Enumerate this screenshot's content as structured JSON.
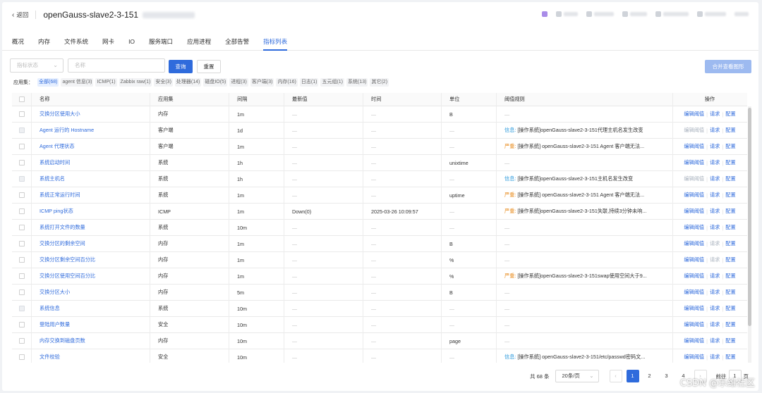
{
  "header": {
    "back_label": "返回",
    "host_title": "openGauss-slave2-3-151"
  },
  "tabs": [
    "概况",
    "内存",
    "文件系统",
    "网卡",
    "IO",
    "服务端口",
    "应用进程",
    "全部告警",
    "指标列表"
  ],
  "active_tab": 8,
  "filters": {
    "status_placeholder": "指标状态",
    "name_placeholder": "名称",
    "query_label": "查询",
    "reset_label": "重置",
    "merge_label": "合并查看图形"
  },
  "appset": {
    "label": "应用集：",
    "chips": [
      "全部(68)",
      "agent 信息(3)",
      "ICMP(1)",
      "Zabbix raw(1)",
      "安全(3)",
      "处理器(14)",
      "磁盘IO(5)",
      "进程(3)",
      "客户端(3)",
      "内存(16)",
      "日志(1)",
      "五元组(1)",
      "系统(13)",
      "其它(2)"
    ]
  },
  "table": {
    "columns": [
      "名称",
      "应用集",
      "间隔",
      "最新值",
      "时间",
      "单位",
      "阈值规则",
      "操作"
    ],
    "rows": [
      {
        "name": "交换分区使用大小",
        "app": "内存",
        "interval": "1m",
        "latest": "—",
        "time": "—",
        "unit": "B",
        "level": "",
        "rule": "—",
        "disabled": false,
        "edit_dim": false,
        "req_dim": false
      },
      {
        "name": "Agent 运行的 Hostname",
        "app": "客户端",
        "interval": "1d",
        "latest": "—",
        "time": "—",
        "unit": "—",
        "level": "信息:",
        "rule": "[操作系统]openGauss-slave2-3-151代理主机名发生改变",
        "disabled": true,
        "edit_dim": true,
        "req_dim": false
      },
      {
        "name": "Agent 代理状态",
        "app": "客户端",
        "interval": "1m",
        "latest": "—",
        "time": "—",
        "unit": "—",
        "level": "严重:",
        "rule": "[操作系统] openGauss-slave2-3-151 Agent 客户端无法...",
        "disabled": false,
        "edit_dim": false,
        "req_dim": false
      },
      {
        "name": "系统启动时间",
        "app": "系统",
        "interval": "1h",
        "latest": "—",
        "time": "—",
        "unit": "unixtime",
        "level": "",
        "rule": "—",
        "disabled": false,
        "edit_dim": false,
        "req_dim": false
      },
      {
        "name": "系统主机名",
        "app": "系统",
        "interval": "1h",
        "latest": "—",
        "time": "—",
        "unit": "—",
        "level": "信息:",
        "rule": "[操作系统]openGauss-slave2-3-151主机名发生改变",
        "disabled": true,
        "edit_dim": true,
        "req_dim": false
      },
      {
        "name": "系统正常运行时间",
        "app": "系统",
        "interval": "1m",
        "latest": "—",
        "time": "—",
        "unit": "uptime",
        "level": "严重:",
        "rule": "[操作系统] openGauss-slave2-3-151 Agent 客户端无法...",
        "disabled": false,
        "edit_dim": false,
        "req_dim": false
      },
      {
        "name": "ICMP ping状态",
        "app": "ICMP",
        "interval": "1m",
        "latest": "Down(0)",
        "time": "2025-03-26 10:09:57",
        "unit": "—",
        "level": "严重:",
        "rule": "[操作系统]openGauss-slave2-3-151失联,持续3分钟未响...",
        "disabled": false,
        "edit_dim": false,
        "req_dim": false
      },
      {
        "name": "系统打开文件的数量",
        "app": "系统",
        "interval": "10m",
        "latest": "—",
        "time": "—",
        "unit": "—",
        "level": "",
        "rule": "—",
        "disabled": false,
        "edit_dim": false,
        "req_dim": false
      },
      {
        "name": "交换分区的剩余空间",
        "app": "内存",
        "interval": "1m",
        "latest": "—",
        "time": "—",
        "unit": "B",
        "level": "",
        "rule": "—",
        "disabled": false,
        "edit_dim": false,
        "req_dim": true
      },
      {
        "name": "交换分区剩余空间百分比",
        "app": "内存",
        "interval": "1m",
        "latest": "—",
        "time": "—",
        "unit": "%",
        "level": "",
        "rule": "—",
        "disabled": false,
        "edit_dim": false,
        "req_dim": true
      },
      {
        "name": "交换分区使用空间百分比",
        "app": "内存",
        "interval": "1m",
        "latest": "—",
        "time": "—",
        "unit": "%",
        "level": "严重:",
        "rule": "[操作系统]openGauss-slave2-3-151swap使用空间大于9...",
        "disabled": false,
        "edit_dim": false,
        "req_dim": false
      },
      {
        "name": "交换分区大小",
        "app": "内存",
        "interval": "5m",
        "latest": "—",
        "time": "—",
        "unit": "B",
        "level": "",
        "rule": "—",
        "disabled": false,
        "edit_dim": false,
        "req_dim": false
      },
      {
        "name": "系统信息",
        "app": "系统",
        "interval": "10m",
        "latest": "—",
        "time": "—",
        "unit": "—",
        "level": "",
        "rule": "—",
        "disabled": true,
        "edit_dim": false,
        "req_dim": false
      },
      {
        "name": "登陆用户数量",
        "app": "安全",
        "interval": "10m",
        "latest": "—",
        "time": "—",
        "unit": "—",
        "level": "",
        "rule": "—",
        "disabled": false,
        "edit_dim": false,
        "req_dim": false
      },
      {
        "name": "内存交换到磁盘页数",
        "app": "内存",
        "interval": "10m",
        "latest": "—",
        "time": "—",
        "unit": "page",
        "level": "",
        "rule": "—",
        "disabled": false,
        "edit_dim": false,
        "req_dim": false
      },
      {
        "name": "文件校验",
        "app": "安全",
        "interval": "10m",
        "latest": "—",
        "time": "—",
        "unit": "—",
        "level": "信息:",
        "rule": "[操作系统] openGauss-slave2-3-151/etc/passwd密码文...",
        "disabled": false,
        "edit_dim": false,
        "req_dim": false
      }
    ],
    "ops": {
      "edit": "编辑阈值",
      "request": "请求",
      "config": "配置"
    }
  },
  "pagination": {
    "total": "共 68 条",
    "page_size": "20条/页",
    "pages": [
      "1",
      "2",
      "3",
      "4"
    ],
    "current": "1",
    "prev": "‹",
    "next": "›",
    "goto_label": "前往",
    "goto_value": "1",
    "goto_suffix": "页"
  },
  "watermark": "CSDN @乐维社区",
  "colors": {
    "primary": "#2f6bdc",
    "info": "#2f9bdc",
    "severe": "#e88a1a"
  }
}
